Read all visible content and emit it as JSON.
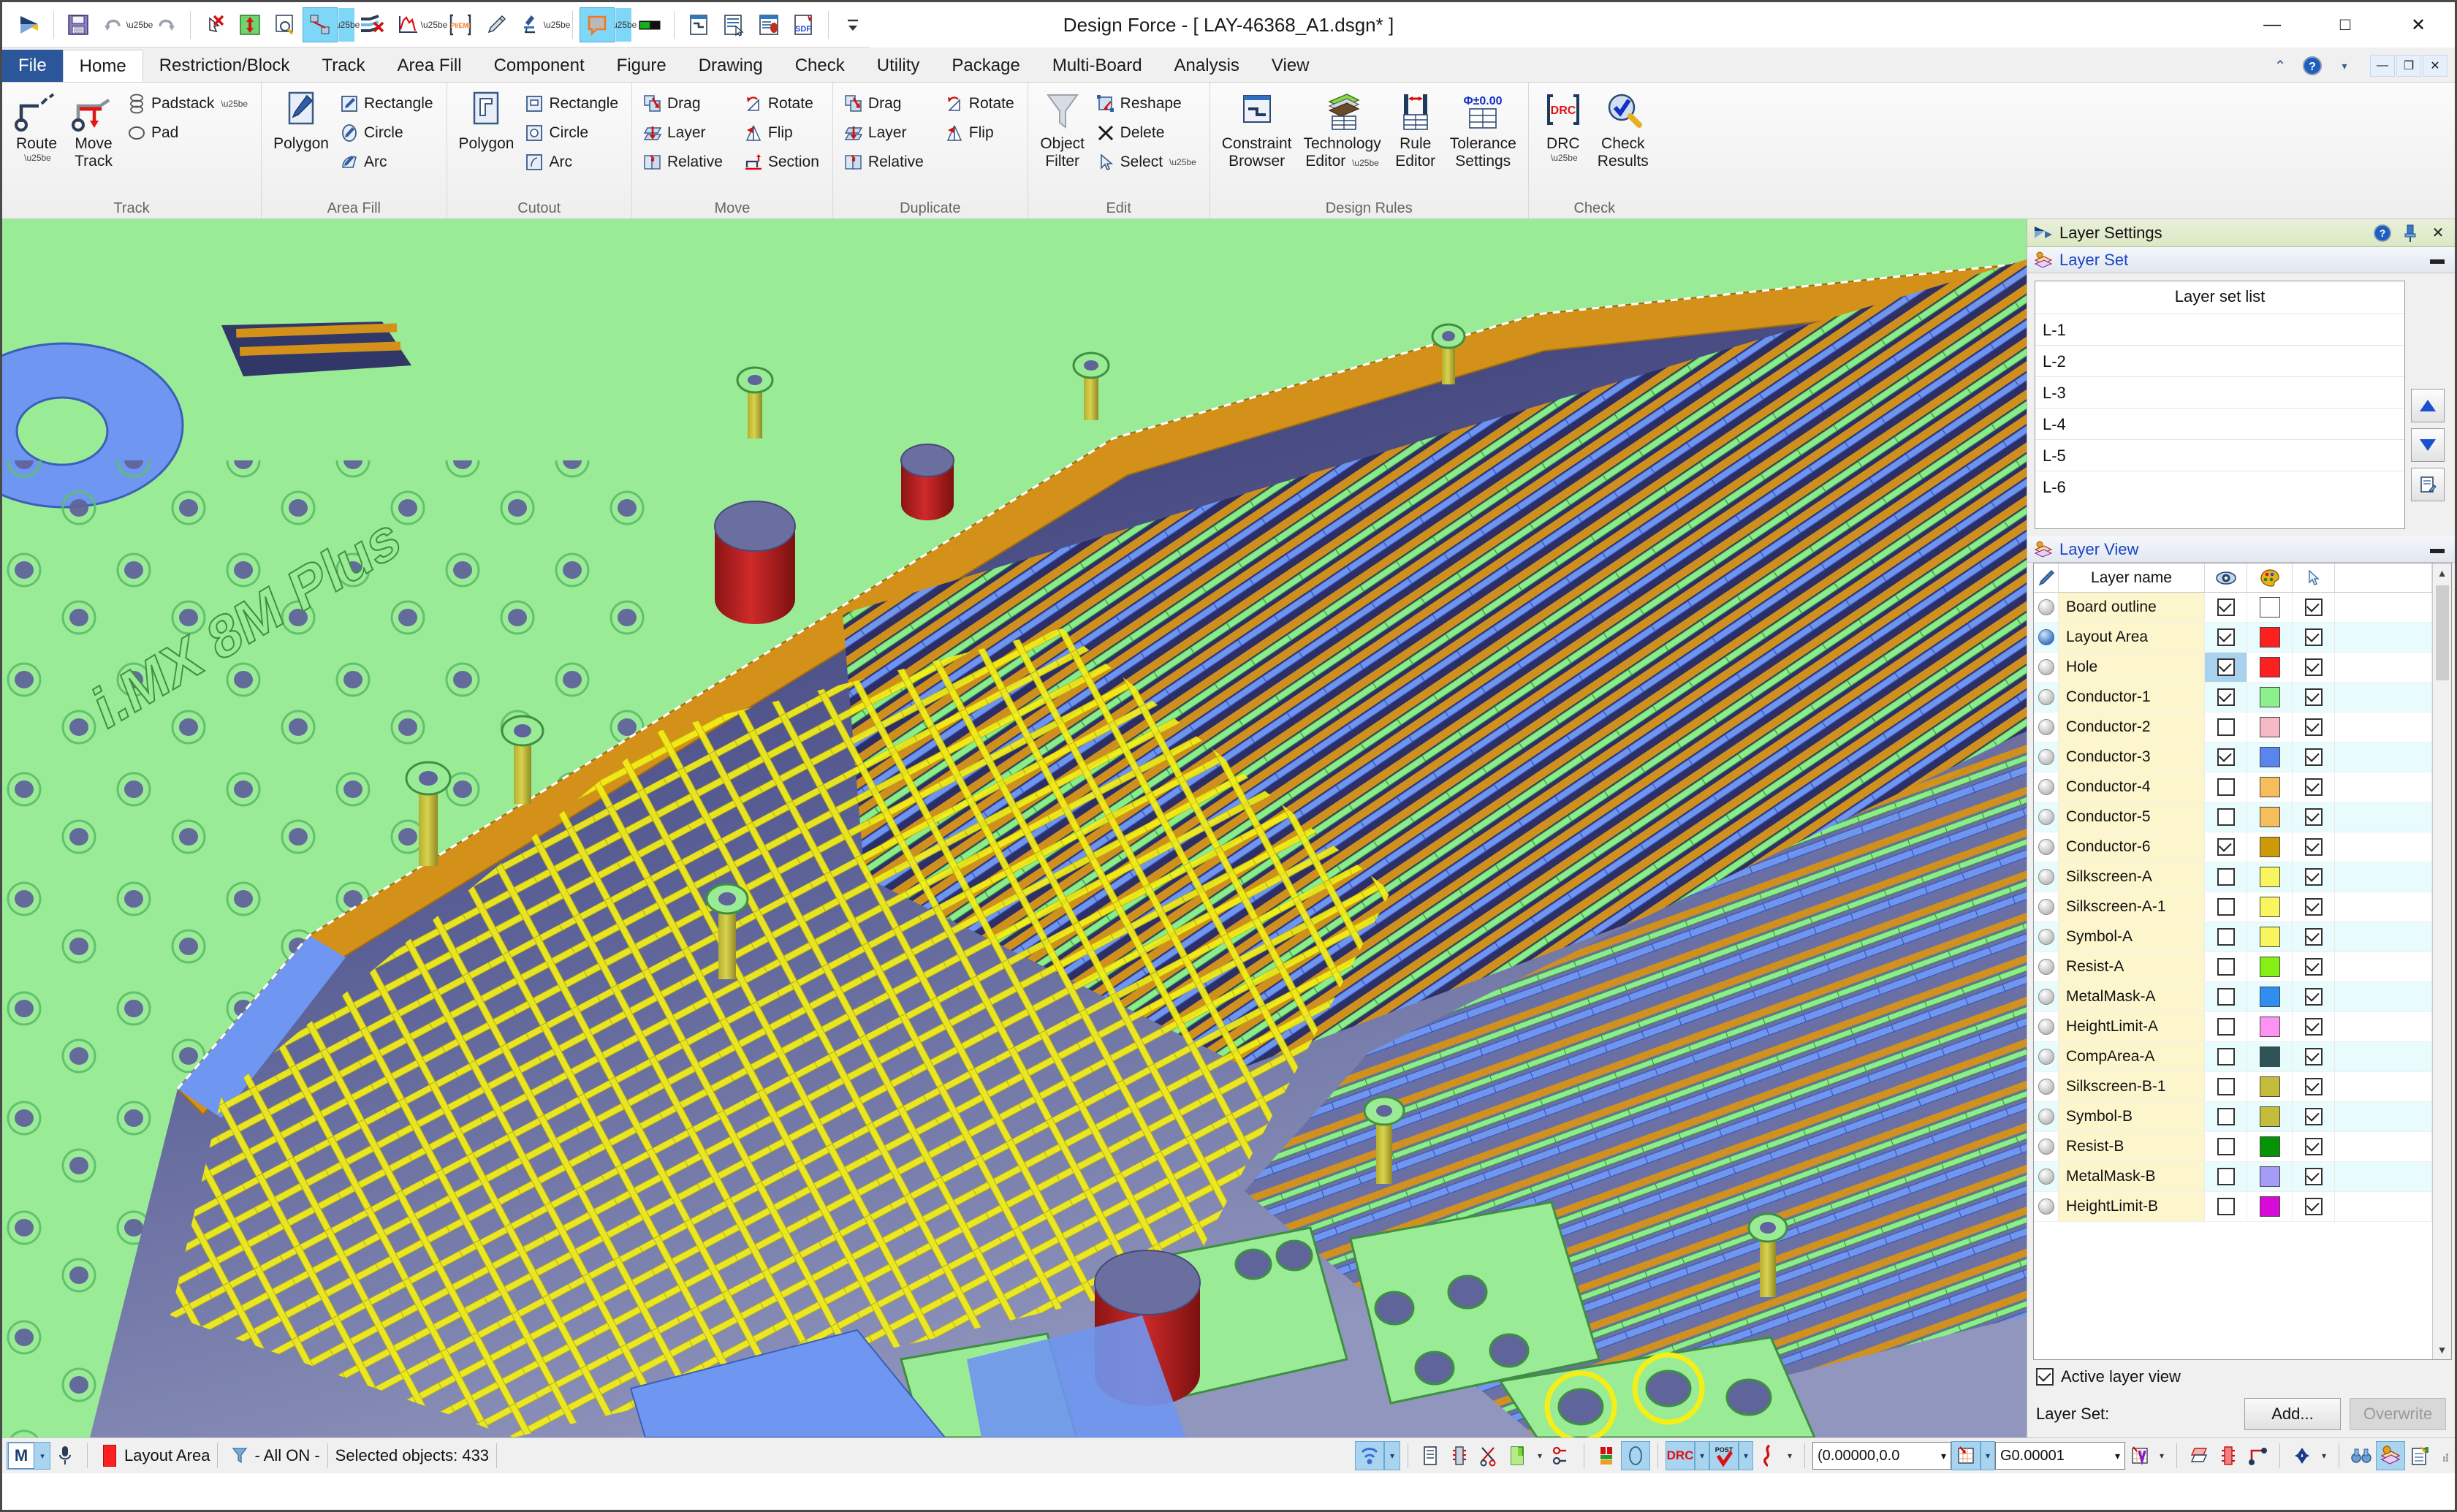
{
  "window": {
    "title": "Design Force - [ LAY-46368_A1.dsgn* ]",
    "minimize": "—",
    "maximize": "□",
    "close": "✕"
  },
  "quick_access": {
    "icons": [
      {
        "name": "app-logo-icon",
        "label": "Design Force"
      },
      {
        "name": "save-icon",
        "label": "Save"
      },
      {
        "name": "undo-icon",
        "label": "Undo"
      },
      {
        "name": "undo-dropdown-icon",
        "label": "Undo history"
      },
      {
        "name": "redo-icon",
        "label": "Redo"
      },
      {
        "name": "delete-select-icon",
        "label": "Delete selection"
      },
      {
        "name": "move-arrows-icon",
        "label": "Move"
      },
      {
        "name": "zoom-icon",
        "label": "Zoom"
      },
      {
        "name": "place-component-icon",
        "label": "Place component"
      },
      {
        "name": "place-component-dropdown-icon",
        "label": "Place component options"
      },
      {
        "name": "unroute-icon",
        "label": "Unroute"
      },
      {
        "name": "waveform-icon",
        "label": "Waveform"
      },
      {
        "name": "waveform-dropdown-icon",
        "label": "Waveform options"
      },
      {
        "name": "pi-emi-icon",
        "label": "PI/EMI"
      },
      {
        "name": "brush-icon",
        "label": "Brush"
      },
      {
        "name": "microscope-icon",
        "label": "Inspect"
      },
      {
        "name": "microscope-dropdown-icon",
        "label": "Inspect options"
      },
      {
        "name": "balloon-icon",
        "label": "Callout"
      },
      {
        "name": "balloon-dropdown-icon",
        "label": "Callout options"
      },
      {
        "name": "toggle-icon",
        "label": "Toggle"
      },
      {
        "name": "report-icon",
        "label": "Report"
      },
      {
        "name": "list-select-icon",
        "label": "List select"
      },
      {
        "name": "db-icon",
        "label": "Database"
      },
      {
        "name": "sdf-icon",
        "label": "SDF"
      },
      {
        "name": "qat-more-icon",
        "label": "Customize Quick Access Toolbar"
      }
    ]
  },
  "tabs": {
    "file": "File",
    "items": [
      "Home",
      "Restriction/Block",
      "Track",
      "Area Fill",
      "Component",
      "Figure",
      "Drawing",
      "Check",
      "Utility",
      "Package",
      "Multi-Board",
      "Analysis",
      "View"
    ],
    "active": "Home",
    "right_icons": [
      {
        "name": "ribbon-collapse-icon",
        "glyph": "⌃"
      },
      {
        "name": "help-icon",
        "glyph": "?"
      },
      {
        "name": "help-dropdown-icon",
        "glyph": "▾"
      }
    ],
    "doc_buttons": [
      {
        "name": "doc-minimize-button",
        "glyph": "—"
      },
      {
        "name": "doc-restore-button",
        "glyph": "❐"
      },
      {
        "name": "doc-close-button",
        "glyph": "✕"
      }
    ]
  },
  "ribbon": {
    "groups": [
      {
        "title": "Track",
        "big": [
          {
            "name": "route-button",
            "label": "Route",
            "caret": true,
            "icon": "route-icon"
          },
          {
            "name": "move-track-button",
            "label": "Move\nTrack",
            "caret": false,
            "icon": "move-track-icon"
          }
        ],
        "small": [
          {
            "name": "padstack-button",
            "label": "Padstack",
            "icon": "padstack-icon",
            "caret": true
          },
          {
            "name": "pad-button",
            "label": "Pad",
            "icon": "pad-icon",
            "caret": false
          }
        ]
      },
      {
        "title": "Area Fill",
        "big": [
          {
            "name": "areafill-polygon-button",
            "label": "Polygon",
            "caret": false,
            "icon": "polygon-pen-icon"
          }
        ],
        "small": [
          {
            "name": "areafill-rectangle-button",
            "label": "Rectangle",
            "icon": "rectangle-pen-icon",
            "caret": false
          },
          {
            "name": "areafill-circle-button",
            "label": "Circle",
            "icon": "circle-pen-icon",
            "caret": false
          },
          {
            "name": "areafill-arc-button",
            "label": "Arc",
            "icon": "arc-pen-icon",
            "caret": false
          }
        ]
      },
      {
        "title": "Cutout",
        "big": [
          {
            "name": "cutout-polygon-button",
            "label": "Polygon",
            "caret": false,
            "icon": "cutout-polygon-icon"
          }
        ],
        "small": [
          {
            "name": "cutout-rectangle-button",
            "label": "Rectangle",
            "icon": "cutout-rect-icon",
            "caret": false
          },
          {
            "name": "cutout-circle-button",
            "label": "Circle",
            "icon": "cutout-circle-icon",
            "caret": false
          },
          {
            "name": "cutout-arc-button",
            "label": "Arc",
            "icon": "cutout-arc-icon",
            "caret": false
          }
        ]
      },
      {
        "title": "Move",
        "small2": [
          {
            "name": "move-drag-button",
            "label": "Drag",
            "icon": "drag-icon"
          },
          {
            "name": "move-rotate-button",
            "label": "Rotate",
            "icon": "rotate-icon"
          },
          {
            "name": "move-layer-button",
            "label": "Layer",
            "icon": "layer-icon"
          },
          {
            "name": "move-flip-button",
            "label": "Flip",
            "icon": "flip-icon"
          },
          {
            "name": "move-relative-button",
            "label": "Relative",
            "icon": "relative-icon"
          },
          {
            "name": "move-section-button",
            "label": "Section",
            "icon": "section-icon"
          }
        ]
      },
      {
        "title": "Duplicate",
        "small2": [
          {
            "name": "duplicate-drag-button",
            "label": "Drag",
            "icon": "drag-icon"
          },
          {
            "name": "duplicate-rotate-button",
            "label": "Rotate",
            "icon": "rotate-icon"
          },
          {
            "name": "duplicate-layer-button",
            "label": "Layer",
            "icon": "layer-icon"
          },
          {
            "name": "duplicate-flip-button",
            "label": "Flip",
            "icon": "flip-icon"
          },
          {
            "name": "duplicate-relative-button",
            "label": "Relative",
            "icon": "relative-icon"
          }
        ]
      },
      {
        "title": "Edit",
        "big": [
          {
            "name": "object-filter-button",
            "label": "Object\nFilter",
            "caret": false,
            "icon": "funnel-icon"
          }
        ],
        "small": [
          {
            "name": "reshape-button",
            "label": "Reshape",
            "icon": "reshape-icon",
            "caret": false
          },
          {
            "name": "delete-button",
            "label": "Delete",
            "icon": "delete-x-icon",
            "caret": false
          },
          {
            "name": "select-button",
            "label": "Select",
            "icon": "cursor-icon",
            "caret": true
          }
        ]
      },
      {
        "title": "Design Rules",
        "big": [
          {
            "name": "constraint-browser-button",
            "label": "Constraint\nBrowser",
            "caret": false,
            "icon": "constraint-browser-icon"
          },
          {
            "name": "technology-editor-button",
            "label": "Technology\nEditor",
            "caret": true,
            "icon": "technology-editor-icon"
          },
          {
            "name": "rule-editor-button",
            "label": "Rule\nEditor",
            "caret": false,
            "icon": "rule-editor-icon"
          },
          {
            "name": "tolerance-settings-button",
            "label": "Tolerance\nSettings",
            "caret": false,
            "icon": "tolerance-settings-icon"
          }
        ]
      },
      {
        "title": "Check",
        "big": [
          {
            "name": "drc-button",
            "label": "DRC",
            "caret": true,
            "icon": "drc-icon"
          },
          {
            "name": "check-results-button",
            "label": "Check\nResults",
            "caret": false,
            "icon": "check-results-icon"
          }
        ]
      }
    ]
  },
  "panel": {
    "title": "Layer Settings",
    "head_icons": [
      {
        "name": "panel-help-icon",
        "glyph": "?"
      },
      {
        "name": "panel-pin-icon",
        "glyph": "📌"
      },
      {
        "name": "panel-close-icon",
        "glyph": "✕"
      }
    ],
    "layer_set": {
      "section_title": "Layer Set",
      "list_title": "Layer set list",
      "items": [
        "L-1",
        "L-2",
        "L-3",
        "L-4",
        "L-5",
        "L-6"
      ],
      "buttons": [
        {
          "name": "layerset-move-up-button",
          "glyph": "▲"
        },
        {
          "name": "layerset-move-down-button",
          "glyph": "▼"
        },
        {
          "name": "layerset-edit-button",
          "glyph": "✎"
        }
      ]
    },
    "layer_view": {
      "section_title": "Layer View",
      "columns": {
        "pen": "pen-icon",
        "name": "Layer name",
        "visible": "eye-icon",
        "color": "palette-icon",
        "select": "cursor-icon"
      },
      "rows": [
        {
          "name": "Board outline",
          "active": false,
          "visible": true,
          "color": "#ffffff",
          "select": true,
          "eye_highlight": false
        },
        {
          "name": "Layout Area",
          "active": true,
          "visible": true,
          "color": "#fd2020",
          "select": true,
          "eye_highlight": false
        },
        {
          "name": "Hole",
          "active": false,
          "visible": true,
          "color": "#fd2020",
          "select": true,
          "eye_highlight": true
        },
        {
          "name": "Conductor-1",
          "active": false,
          "visible": true,
          "color": "#8cf08c",
          "select": true,
          "eye_highlight": false
        },
        {
          "name": "Conductor-2",
          "active": false,
          "visible": false,
          "color": "#f5b8c4",
          "select": true,
          "eye_highlight": false
        },
        {
          "name": "Conductor-3",
          "active": false,
          "visible": true,
          "color": "#5a84ee",
          "select": true,
          "eye_highlight": false
        },
        {
          "name": "Conductor-4",
          "active": false,
          "visible": false,
          "color": "#f5bd5c",
          "select": true,
          "eye_highlight": false
        },
        {
          "name": "Conductor-5",
          "active": false,
          "visible": false,
          "color": "#f5bd5c",
          "select": true,
          "eye_highlight": false
        },
        {
          "name": "Conductor-6",
          "active": false,
          "visible": true,
          "color": "#cc9a08",
          "select": true,
          "eye_highlight": false
        },
        {
          "name": "Silkscreen-A",
          "active": false,
          "visible": false,
          "color": "#f8f55e",
          "select": true,
          "eye_highlight": false
        },
        {
          "name": "Silkscreen-A-1",
          "active": false,
          "visible": false,
          "color": "#f8f55e",
          "select": true,
          "eye_highlight": false
        },
        {
          "name": "Symbol-A",
          "active": false,
          "visible": false,
          "color": "#f8f55e",
          "select": true,
          "eye_highlight": false
        },
        {
          "name": "Resist-A",
          "active": false,
          "visible": false,
          "color": "#86ef14",
          "select": true,
          "eye_highlight": false
        },
        {
          "name": "MetalMask-A",
          "active": false,
          "visible": false,
          "color": "#2f8ef0",
          "select": true,
          "eye_highlight": false
        },
        {
          "name": "HeightLimit-A",
          "active": false,
          "visible": false,
          "color": "#fc93f2",
          "select": true,
          "eye_highlight": false
        },
        {
          "name": "CompArea-A",
          "active": false,
          "visible": false,
          "color": "#2e5356",
          "select": true,
          "eye_highlight": false
        },
        {
          "name": "Silkscreen-B-1",
          "active": false,
          "visible": false,
          "color": "#c4bd3c",
          "select": true,
          "eye_highlight": false
        },
        {
          "name": "Symbol-B",
          "active": false,
          "visible": false,
          "color": "#c4bd3c",
          "select": true,
          "eye_highlight": false
        },
        {
          "name": "Resist-B",
          "active": false,
          "visible": false,
          "color": "#059405",
          "select": true,
          "eye_highlight": false
        },
        {
          "name": "MetalMask-B",
          "active": false,
          "visible": false,
          "color": "#a49cf7",
          "select": true,
          "eye_highlight": false
        },
        {
          "name": "HeightLimit-B",
          "active": false,
          "visible": false,
          "color": "#d80ad8",
          "select": true,
          "eye_highlight": false
        }
      ]
    },
    "footer": {
      "active_layer_view_label": "Active layer view",
      "active_layer_view_checked": true,
      "layer_set_label": "Layer Set:",
      "add_button": "Add...",
      "overwrite_button": "Overwrite"
    }
  },
  "statusbar": {
    "ime": {
      "letter": "M",
      "caret": "▾"
    },
    "mic_icon": "microphone-icon",
    "active_layer_swatch": "#fd2020",
    "active_layer": "Layout Area",
    "filter_text": "- All ON -",
    "selection_text": "Selected objects: 433",
    "right_icons": [
      {
        "name": "wireless-net-icon",
        "selected": true
      },
      {
        "name": "wireless-dropdown-icon",
        "selected": true
      },
      {
        "name": "net-list-icon",
        "selected": false
      },
      {
        "name": "component-pin-icon",
        "selected": false
      },
      {
        "name": "unroute-scissors-icon",
        "selected": false
      },
      {
        "name": "area-fill-icon",
        "selected": false
      },
      {
        "name": "area-fill-dropdown-icon",
        "selected": false
      },
      {
        "name": "track-node-icon",
        "selected": false
      },
      {
        "name": "stackup-icon",
        "selected": false
      },
      {
        "name": "3d-view-icon",
        "selected": true
      },
      {
        "name": "drc-icon",
        "selected": true
      },
      {
        "name": "drc-dropdown-icon",
        "selected": true
      },
      {
        "name": "post-check-icon",
        "selected": true
      },
      {
        "name": "post-dropdown-icon",
        "selected": true
      },
      {
        "name": "flex-icon",
        "selected": false
      },
      {
        "name": "flex-dropdown-icon",
        "selected": false
      }
    ],
    "coordinate": "(0.00000,0.0",
    "grid_value": "G0.00001",
    "tail_icons": [
      {
        "name": "grid-snap-icon",
        "selected": false
      },
      {
        "name": "grid-snap-dropdown-icon",
        "selected": false
      },
      {
        "name": "layer-flip-icon",
        "selected": false
      },
      {
        "name": "component-red-icon",
        "selected": false
      },
      {
        "name": "net-point-icon",
        "selected": false
      },
      {
        "name": "mirror-icon",
        "selected": false
      },
      {
        "name": "mirror-dropdown-icon",
        "selected": false
      },
      {
        "name": "binoculars-icon",
        "selected": false
      },
      {
        "name": "layer-settings-icon",
        "selected": true
      },
      {
        "name": "notes-icon",
        "selected": false
      }
    ]
  }
}
